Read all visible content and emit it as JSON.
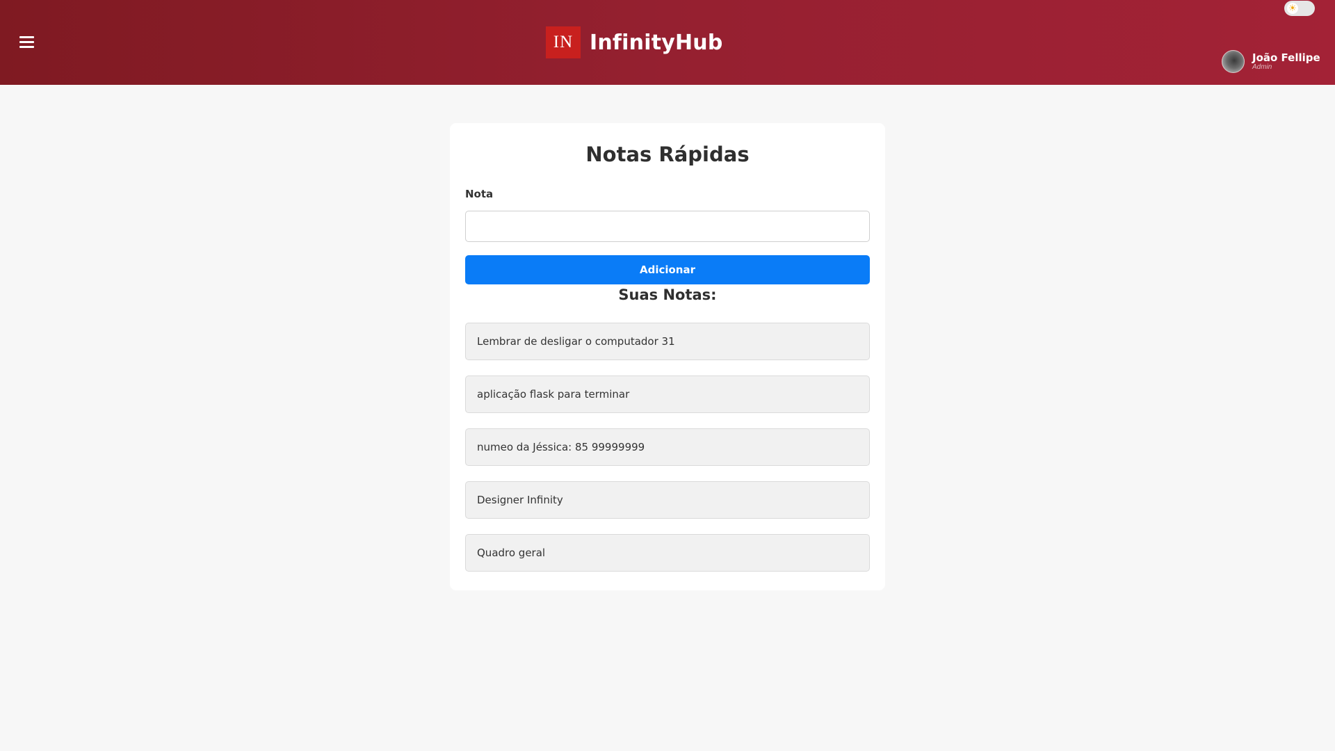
{
  "header": {
    "brand_logo": "IN",
    "brand_name": "InfinityHub",
    "theme_toggle_icon": "sun-icon",
    "user": {
      "name": "João Fellipe",
      "role": "Admin"
    }
  },
  "main": {
    "title": "Notas Rápidas",
    "form": {
      "label": "Nota",
      "input_value": "",
      "placeholder": "",
      "submit_label": "Adicionar"
    },
    "list_title": "Suas Notas:",
    "notes": [
      "Lembrar de desligar o computador 31",
      "aplicação flask para terminar",
      "numeo da Jéssica: 85 99999999",
      "Designer Infinity",
      "Quadro geral"
    ]
  },
  "colors": {
    "header_start": "#7f1a22",
    "header_end": "#a32236",
    "logo_bg": "#c8201e",
    "primary_button": "#0a7cf7",
    "page_bg": "#f7f7f7",
    "note_bg": "#f1f1f1"
  }
}
